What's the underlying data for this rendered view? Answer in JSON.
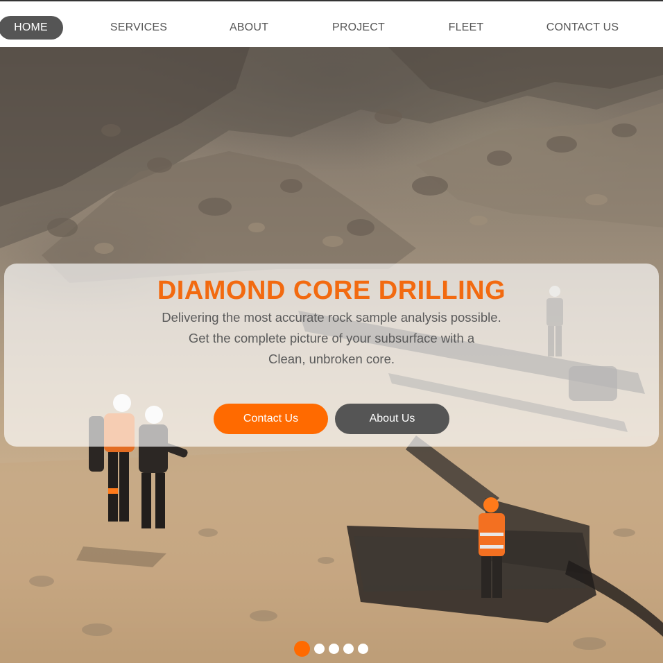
{
  "nav": {
    "items": [
      {
        "label": "HOME",
        "active": true
      },
      {
        "label": "SERVICES",
        "active": false
      },
      {
        "label": "ABOUT",
        "active": false
      },
      {
        "label": "PROJECT",
        "active": false
      },
      {
        "label": "FLEET",
        "active": false
      },
      {
        "label": "CONTACT US",
        "active": false
      }
    ]
  },
  "hero": {
    "title": "DIAMOND CORE DRILLING",
    "lines": [
      "Delivering the most accurate rock sample analysis possible.",
      "Get the complete picture of your subsurface with a",
      "Clean, unbroken core."
    ],
    "primary_button": "Contact Us",
    "secondary_button": "About Us"
  },
  "slider": {
    "slide_count": 5,
    "active_index": 0
  },
  "colors": {
    "accent": "#ff6a00",
    "title": "#f26a10",
    "dark": "#555555"
  }
}
